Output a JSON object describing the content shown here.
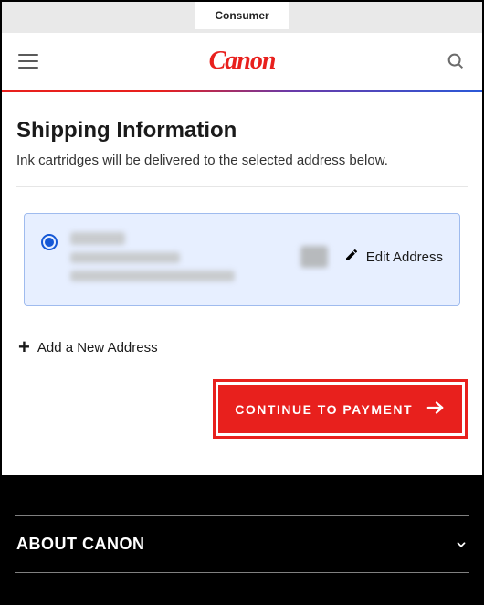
{
  "topbar": {
    "tab_label": "Consumer"
  },
  "header": {
    "logo_text": "Canon"
  },
  "shipping": {
    "title": "Shipping Information",
    "subtitle": "Ink cartridges will be delivered to the selected address below.",
    "edit_label": "Edit Address",
    "add_label": "Add a New Address"
  },
  "cta": {
    "label": "CONTINUE TO PAYMENT"
  },
  "footer": {
    "about_label": "ABOUT CANON"
  }
}
